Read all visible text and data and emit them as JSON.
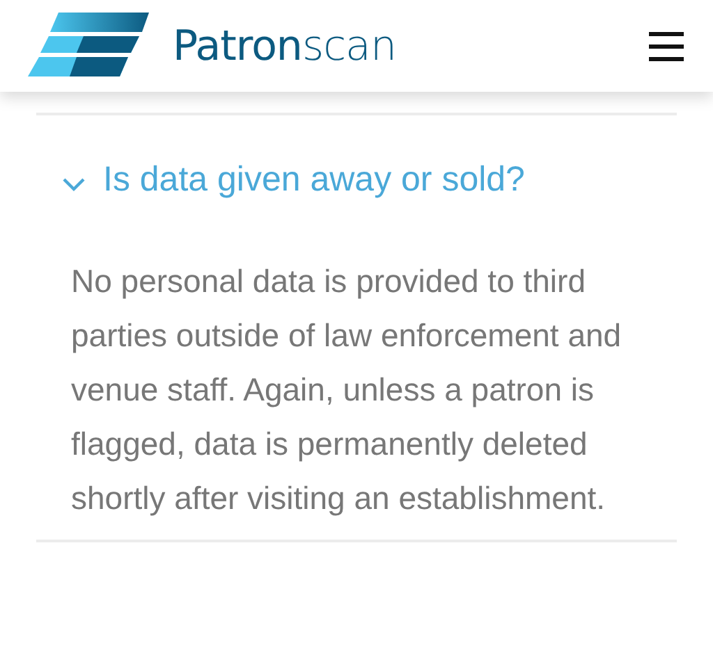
{
  "header": {
    "logo_text": "**Patron**scan"
  },
  "faq": [
    {
      "question": "Is data given away or sold?",
      "expanded": true,
      "answer": "No personal data is provided to third parties outside of law enforcement and venue staff. Again, unless a patron is flagged, data is permanently deleted shortly after visiting an establishment."
    }
  ]
}
